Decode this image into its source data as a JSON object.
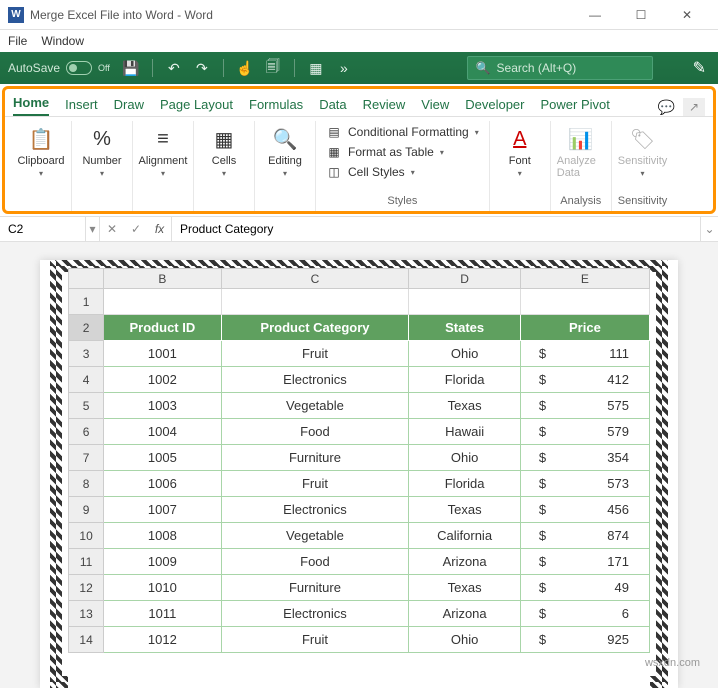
{
  "window": {
    "title": "Merge Excel File into Word - Word",
    "menu_file": "File",
    "menu_window": "Window"
  },
  "qat": {
    "autosave_label": "AutoSave",
    "autosave_state": "Off",
    "search_placeholder": "Search (Alt+Q)"
  },
  "ribbon": {
    "tabs": [
      "Home",
      "Insert",
      "Draw",
      "Page Layout",
      "Formulas",
      "Data",
      "Review",
      "View",
      "Developer",
      "Power Pivot"
    ],
    "active_tab": "Home",
    "groups": {
      "clipboard": {
        "label": "Clipboard"
      },
      "number": {
        "label": "Number"
      },
      "alignment": {
        "label": "Alignment"
      },
      "cells": {
        "label": "Cells"
      },
      "editing": {
        "label": "Editing"
      },
      "styles": {
        "label": "Styles",
        "cond": "Conditional Formatting",
        "fmt_table": "Format as Table",
        "cell_styles": "Cell Styles"
      },
      "font": {
        "label": "Font"
      },
      "analysis": {
        "label": "Analysis",
        "btn": "Analyze Data"
      },
      "sensitivity": {
        "label": "Sensitivity",
        "btn": "Sensitivity"
      }
    }
  },
  "formula_bar": {
    "name_box": "C2",
    "fx": "fx",
    "value": "Product Category"
  },
  "sheet": {
    "col_headers": [
      "B",
      "C",
      "D",
      "E"
    ],
    "header_row": {
      "b": "Product ID",
      "c": "Product Category",
      "d": "States",
      "e": "Price"
    },
    "rows": [
      {
        "n": 3,
        "id": "1001",
        "cat": "Fruit",
        "state": "Ohio",
        "cur": "$",
        "price": "111"
      },
      {
        "n": 4,
        "id": "1002",
        "cat": "Electronics",
        "state": "Florida",
        "cur": "$",
        "price": "412"
      },
      {
        "n": 5,
        "id": "1003",
        "cat": "Vegetable",
        "state": "Texas",
        "cur": "$",
        "price": "575"
      },
      {
        "n": 6,
        "id": "1004",
        "cat": "Food",
        "state": "Hawaii",
        "cur": "$",
        "price": "579"
      },
      {
        "n": 7,
        "id": "1005",
        "cat": "Furniture",
        "state": "Ohio",
        "cur": "$",
        "price": "354"
      },
      {
        "n": 8,
        "id": "1006",
        "cat": "Fruit",
        "state": "Florida",
        "cur": "$",
        "price": "573"
      },
      {
        "n": 9,
        "id": "1007",
        "cat": "Electronics",
        "state": "Texas",
        "cur": "$",
        "price": "456"
      },
      {
        "n": 10,
        "id": "1008",
        "cat": "Vegetable",
        "state": "California",
        "cur": "$",
        "price": "874"
      },
      {
        "n": 11,
        "id": "1009",
        "cat": "Food",
        "state": "Arizona",
        "cur": "$",
        "price": "171"
      },
      {
        "n": 12,
        "id": "1010",
        "cat": "Furniture",
        "state": "Texas",
        "cur": "$",
        "price": "49"
      },
      {
        "n": 13,
        "id": "1011",
        "cat": "Electronics",
        "state": "Arizona",
        "cur": "$",
        "price": "6"
      },
      {
        "n": 14,
        "id": "1012",
        "cat": "Fruit",
        "state": "Ohio",
        "cur": "$",
        "price": "925"
      }
    ]
  },
  "watermark": "wsxdn.com"
}
